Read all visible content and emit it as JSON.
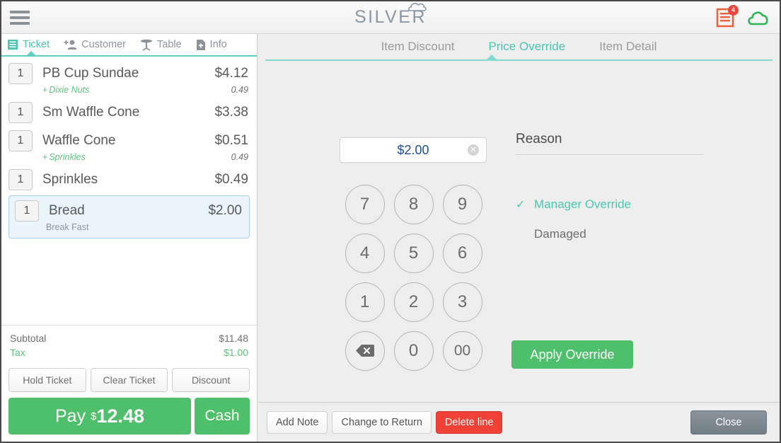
{
  "header": {
    "menu_icon": "hamburger-icon",
    "logo_text": "SILVER",
    "receipt_icon": "receipt-icon",
    "receipt_badge": "4",
    "cloud_icon": "cloud-icon"
  },
  "left_panel": {
    "tabs": [
      {
        "label": "Ticket",
        "icon": "ticket-icon",
        "active": true
      },
      {
        "label": "Customer",
        "icon": "add-person-icon",
        "active": false
      },
      {
        "label": "Table",
        "icon": "table-icon",
        "active": false
      },
      {
        "label": "Info",
        "icon": "document-plus-icon",
        "active": false
      }
    ],
    "items": [
      {
        "qty": "1",
        "name": "PB Cup Sundae",
        "price": "$4.12",
        "modifier": {
          "prefix": "+",
          "name": "Dixie Nuts",
          "price": "0.49"
        },
        "selected": false
      },
      {
        "qty": "1",
        "name": "Sm Waffle Cone",
        "price": "$3.38",
        "selected": false
      },
      {
        "qty": "1",
        "name": "Waffle Cone",
        "price": "$0.51",
        "modifier": {
          "prefix": "+",
          "name": "Sprinkles",
          "price": "0.49"
        },
        "selected": false
      },
      {
        "qty": "1",
        "name": "Sprinkles",
        "price": "$0.49",
        "selected": false
      },
      {
        "qty": "1",
        "name": "Bread",
        "price": "$2.00",
        "subtext": "Break Fast",
        "selected": true
      }
    ],
    "totals": [
      {
        "label": "Subtotal",
        "value": "$11.48",
        "highlight": false
      },
      {
        "label": "Tax",
        "value": "$1.00",
        "highlight": true
      }
    ],
    "action_buttons": [
      "Hold Ticket",
      "Clear Ticket",
      "Discount"
    ],
    "pay": {
      "label": "Pay",
      "dollar": "$",
      "amount": "12.48"
    },
    "cash_label": "Cash"
  },
  "right_panel": {
    "tabs": [
      {
        "label": "Item Discount",
        "active": false
      },
      {
        "label": "Price Override",
        "active": true
      },
      {
        "label": "Item Detail",
        "active": false
      }
    ],
    "price_input": {
      "value": "$2.00",
      "clear_icon": "clear-circle-icon"
    },
    "keypad": [
      "7",
      "8",
      "9",
      "4",
      "5",
      "6",
      "1",
      "2",
      "3",
      "backspace",
      "0",
      "00"
    ],
    "reason": {
      "title": "Reason",
      "options": [
        {
          "label": "Manager Override",
          "selected": true
        },
        {
          "label": "Damaged",
          "selected": false
        }
      ]
    },
    "apply_label": "Apply Override",
    "footer_buttons": [
      {
        "label": "Add Note",
        "style": "default"
      },
      {
        "label": "Change to Return",
        "style": "default"
      },
      {
        "label": "Delete line",
        "style": "danger"
      }
    ],
    "close_label": "Close"
  },
  "colors": {
    "teal": "#49c5b1",
    "green": "#4ec06b",
    "red": "#ef4136",
    "blue_text": "#1f4e8c",
    "select_bg": "#eaf4fb"
  }
}
